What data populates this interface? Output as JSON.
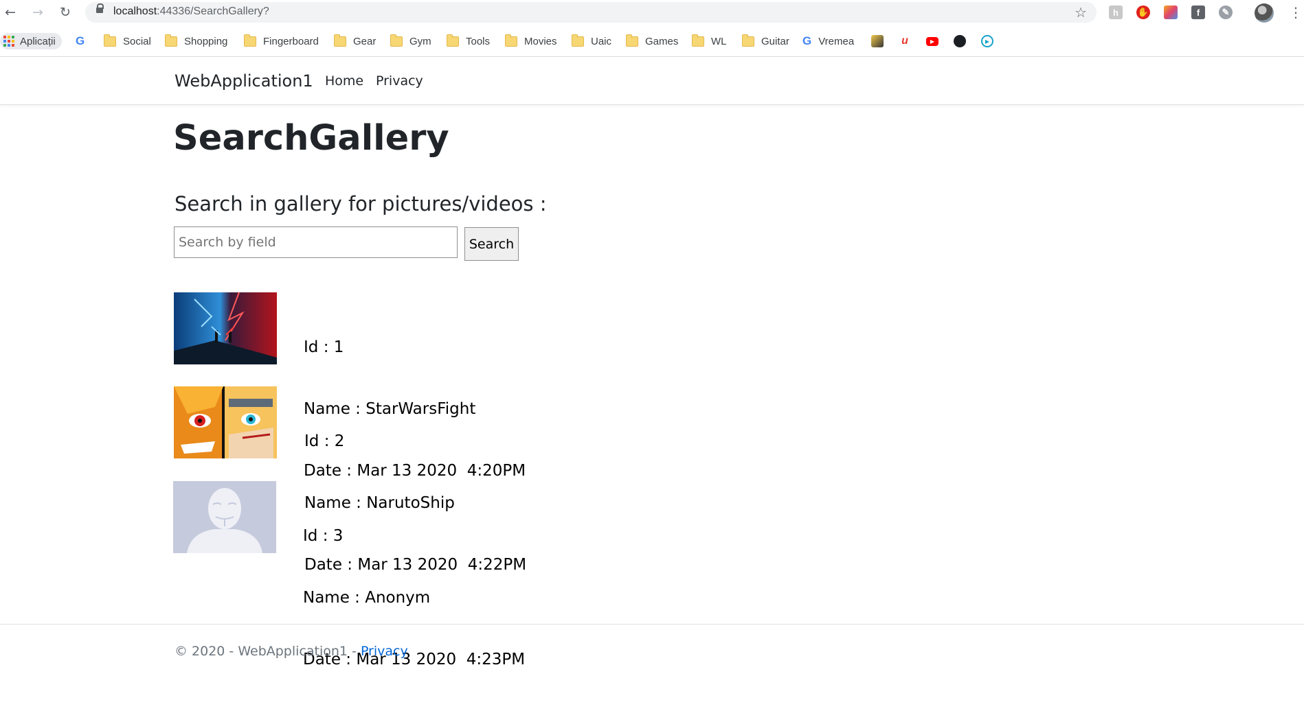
{
  "browser": {
    "url_host": "localhost",
    "url_rest": ":44336/SearchGallery?",
    "bookmarks": {
      "apps": "Aplicații",
      "social": "Social",
      "shopping": "Shopping",
      "fingerboard": "Fingerboard",
      "gear": "Gear",
      "gym": "Gym",
      "tools": "Tools",
      "movies": "Movies",
      "uaic": "Uaic",
      "games": "Games",
      "wl": "WL",
      "guitar": "Guitar",
      "vremea": "Vremea"
    }
  },
  "navbar": {
    "brand": "WebApplication1",
    "home": "Home",
    "privacy": "Privacy"
  },
  "main": {
    "title": "SearchGallery",
    "search_heading": "Search in gallery for pictures/videos :",
    "search_placeholder": "Search by field",
    "search_button": "Search"
  },
  "items": [
    {
      "id_line": "Id : 1",
      "name_line": "Name : StarWarsFight",
      "date_line": "Date : Mar 13 2020  4:20PM"
    },
    {
      "id_line": "Id : 2",
      "name_line": "Name : NarutoShip",
      "date_line": "Date : Mar 13 2020  4:22PM"
    },
    {
      "id_line": "Id : 3",
      "name_line": "Name : Anonym",
      "date_line": "Date : Mar 13 2020  4:23PM"
    }
  ],
  "footer": {
    "text": "© 2020 - WebApplication1 - ",
    "privacy_link": "Privacy"
  }
}
